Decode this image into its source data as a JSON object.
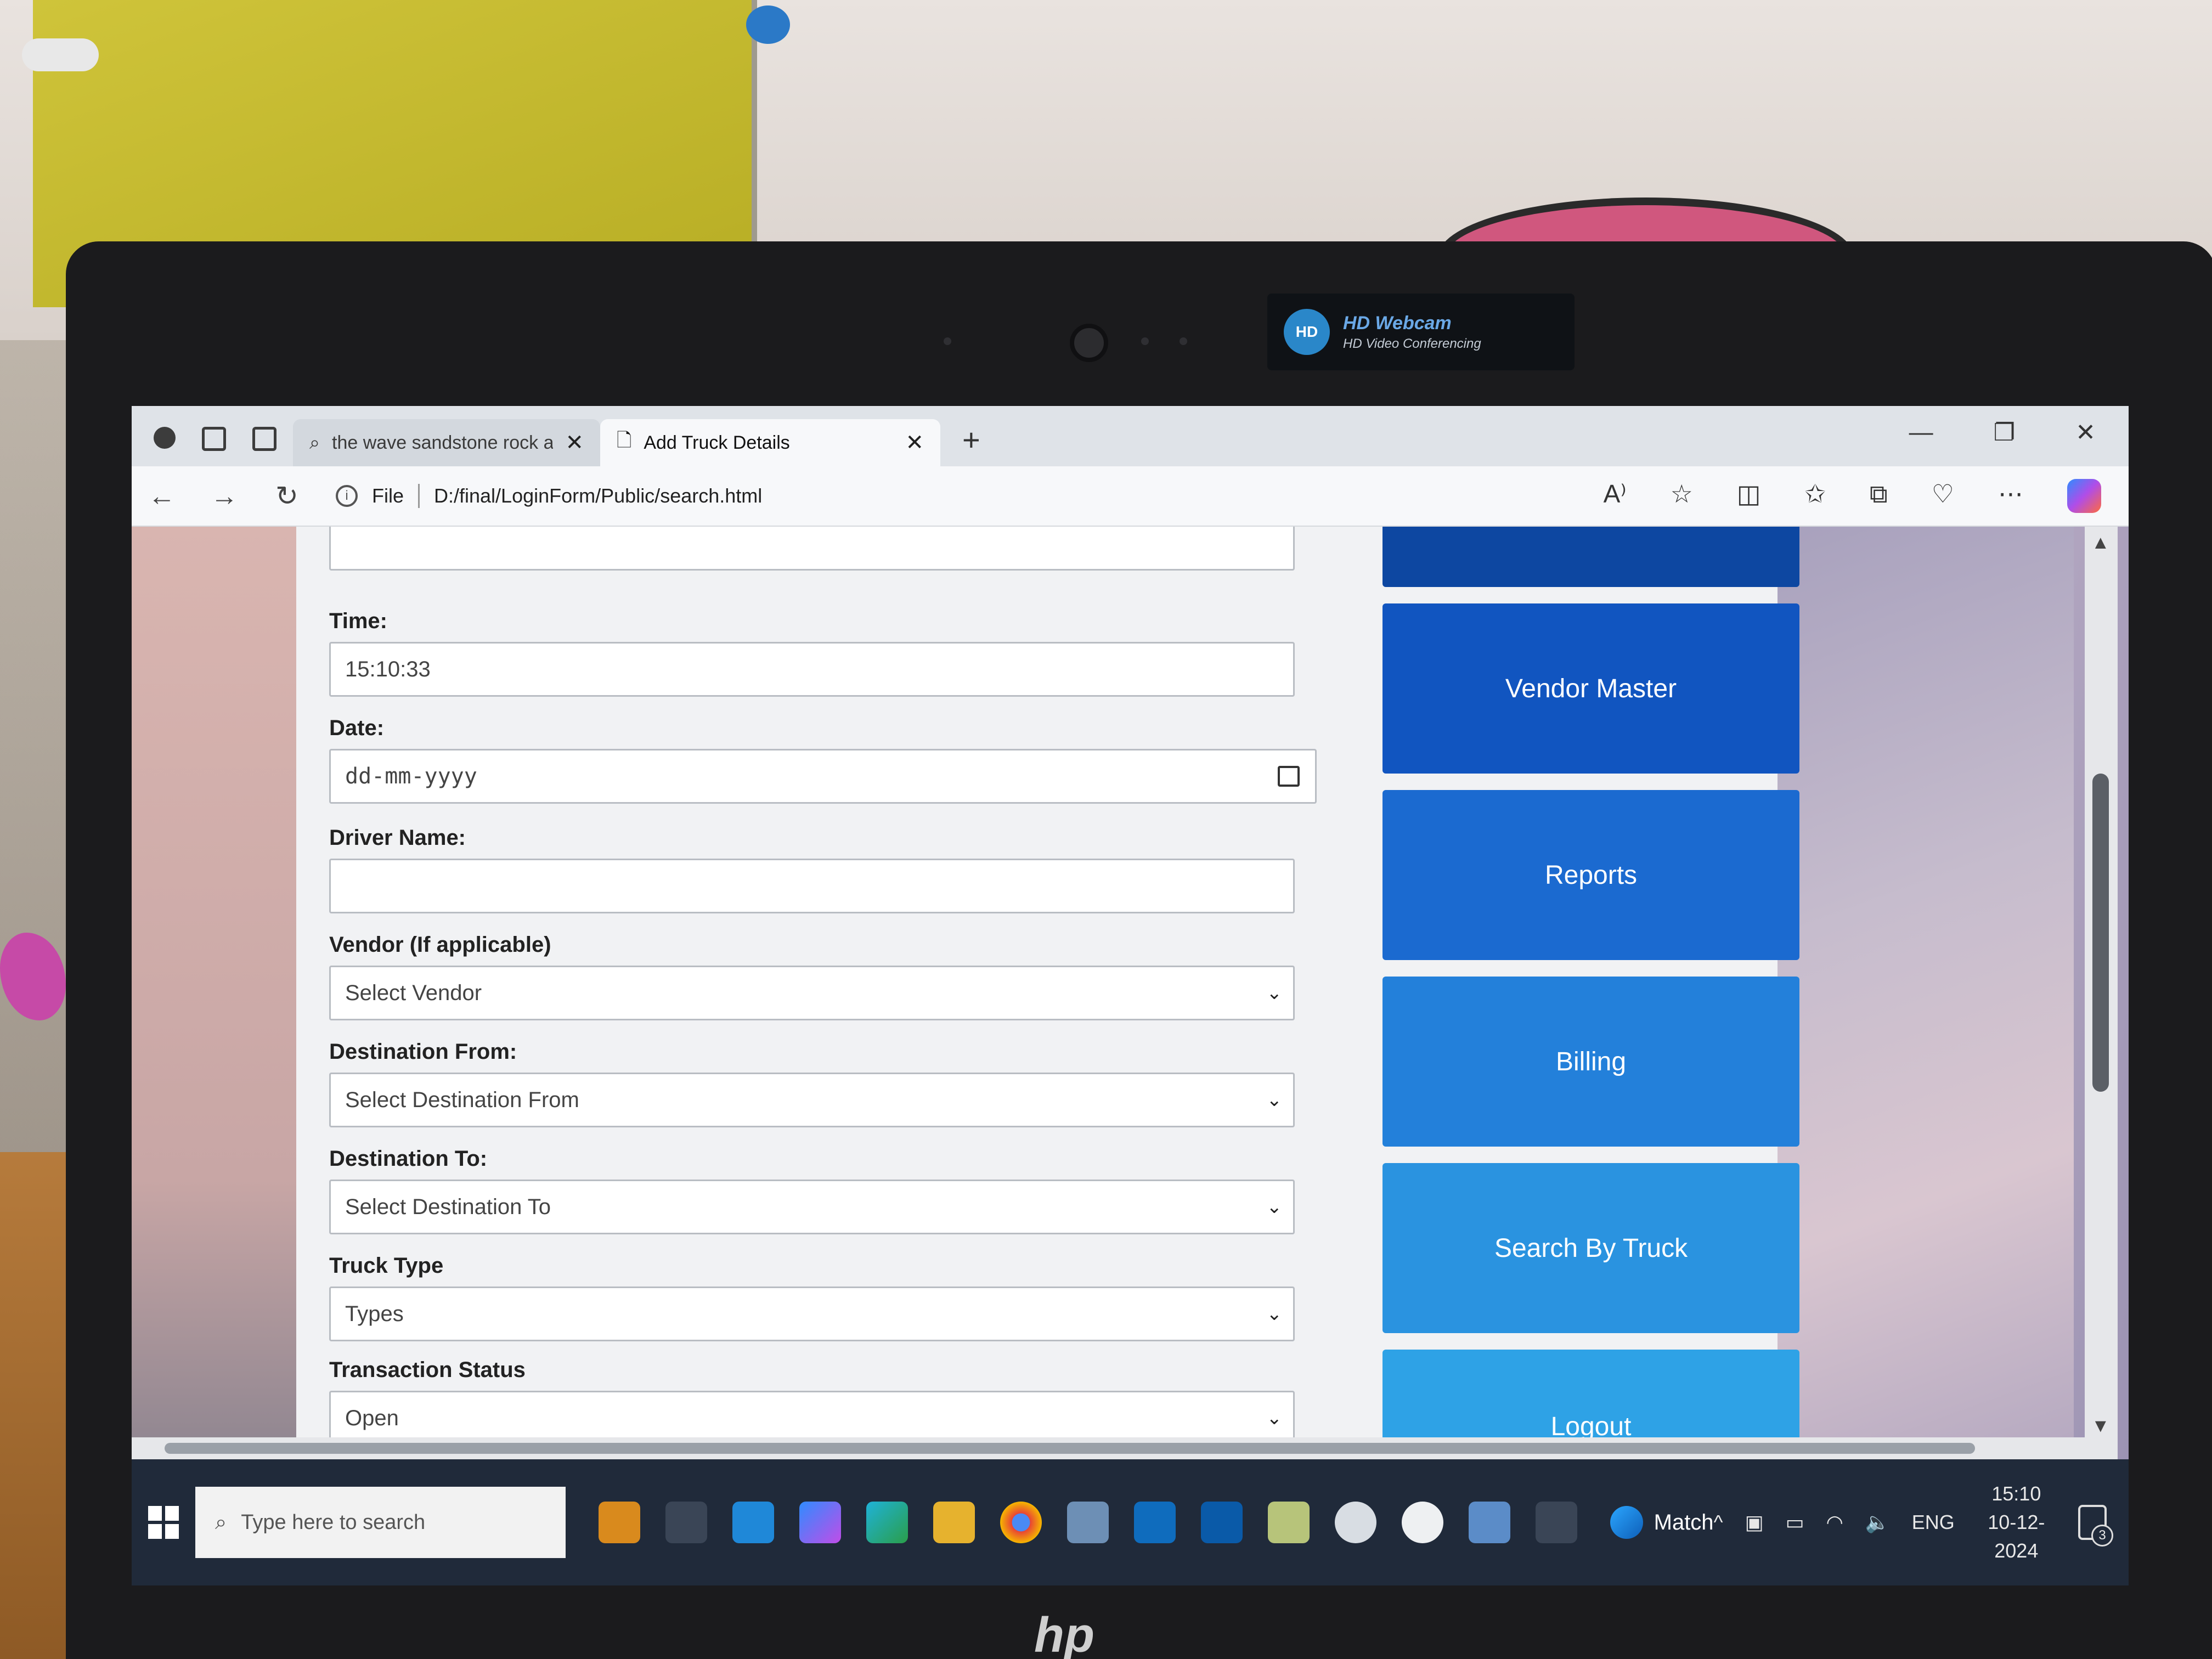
{
  "webcam_badge": {
    "title": "HD Webcam",
    "subtitle": "HD Video Conferencing",
    "icon_text": "HD"
  },
  "laptop_brand": "hp",
  "browser": {
    "tabs": [
      {
        "label": "the wave sandstone rock arizona",
        "active": false
      },
      {
        "label": "Add Truck Details",
        "active": true
      }
    ],
    "address": {
      "scheme_label": "File",
      "url": "D:/final/LoginForm/Public/search.html"
    }
  },
  "form": {
    "time": {
      "label": "Time:",
      "value": "15:10:33"
    },
    "date": {
      "label": "Date:",
      "placeholder": "dd-mm-yyyy"
    },
    "driver_name": {
      "label": "Driver Name:",
      "value": ""
    },
    "vendor": {
      "label": "Vendor (If applicable)",
      "selected": "Select Vendor"
    },
    "destination_from": {
      "label": "Destination From:",
      "selected": "Select Destination From"
    },
    "destination_to": {
      "label": "Destination To:",
      "selected": "Select Destination To"
    },
    "truck_type": {
      "label": "Truck Type",
      "selected": "Types"
    },
    "transaction_status": {
      "label": "Transaction Status",
      "selected": "Open"
    }
  },
  "menu": {
    "items": [
      {
        "label": "",
        "color": "#0d47a1"
      },
      {
        "label": "Vendor Master",
        "color": "#1155c0"
      },
      {
        "label": "Reports",
        "color": "#1b6ad0"
      },
      {
        "label": "Billing",
        "color": "#2380da"
      },
      {
        "label": "Search By Truck",
        "color": "#2a93e0"
      },
      {
        "label": "Logout",
        "color": "#2ea2e6"
      }
    ]
  },
  "taskbar": {
    "search_placeholder": "Type here to search",
    "weather_label": "Match",
    "language": "ENG",
    "time": "15:10",
    "date": "10-12-2024",
    "notification_count": "3"
  }
}
